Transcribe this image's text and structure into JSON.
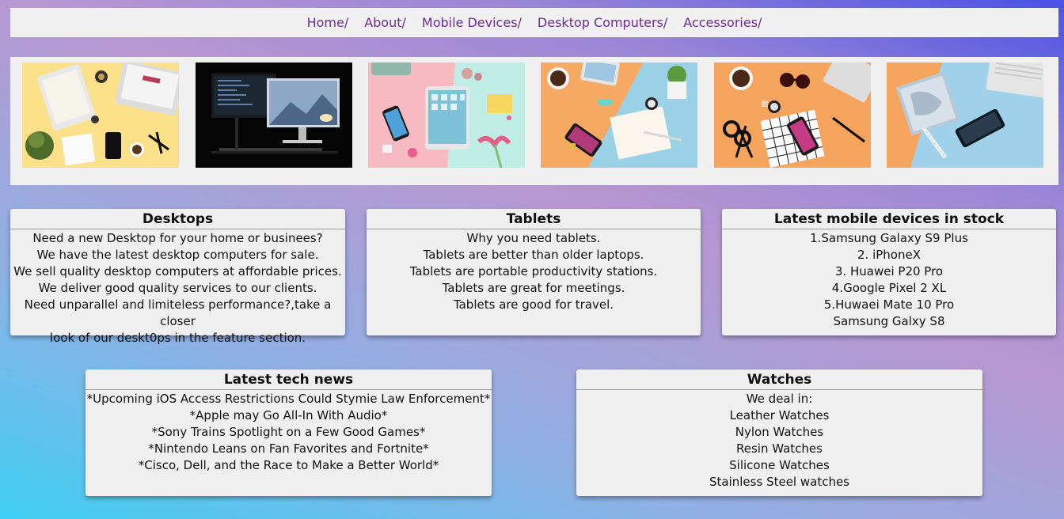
{
  "nav": {
    "items": [
      "Home/",
      "About/",
      "Mobile Devices/",
      "Desktop Computers/",
      "Accessories/"
    ]
  },
  "gallery": {
    "images": [
      "laptop-tablet-workspace-photo",
      "desktop-computer-dark-desk-photo",
      "tablet-phone-pink-desk-photo",
      "tablet-phone-orange-desk-photo",
      "phone-glasses-orange-desk-photo",
      "notebook-phone-blue-desk-photo"
    ]
  },
  "cards": {
    "desktops": {
      "title": "Desktops",
      "lines": [
        "Need a new Desktop for your home or businees?",
        "We have the latest desktop computers for sale.",
        "We sell quality desktop computers at affordable prices.",
        "We deliver good quality services to our clients.",
        "Need unparallel and limiteless performance?,take a closer",
        "look of our deskt0ps in the feature section."
      ]
    },
    "tablets": {
      "title": "Tablets",
      "lines": [
        "Why you need tablets.",
        "Tablets are better than older laptops.",
        "Tablets are portable productivity stations.",
        "Tablets are great for meetings.",
        "Tablets are good for travel."
      ]
    },
    "mobile": {
      "title": "Latest mobile devices in stock",
      "lines": [
        "1.Samsung Galaxy S9 Plus",
        "2. iPhoneX",
        "3. Huawei P20 Pro",
        "4.Google Pixel 2 XL",
        "5.Huwaei Mate 10 Pro",
        "Samsung Galxy S8"
      ]
    },
    "news": {
      "title": "Latest tech news",
      "lines": [
        "*Upcoming iOS Access Restrictions Could Stymie Law Enforcement*",
        "*Apple may Go All-In With Audio*",
        "*Sony Trains Spotlight on a Few Good Games*",
        "*Nintendo Leans on Fan Favorites and Fortnite*",
        "*Cisco, Dell, and the Race to Make a Better World*"
      ]
    },
    "watches": {
      "title": "Watches",
      "lines": [
        "We deal in:",
        "Leather Watches",
        "Nylon Watches",
        "Resin Watches",
        "Silicone Watches",
        "Stainless Steel watches"
      ]
    }
  },
  "colors": {
    "nav_link": "#6a2c91",
    "panel_bg": "#efefef",
    "gradient_top": "#4a52e6",
    "gradient_bottom": "#3fcff4"
  }
}
